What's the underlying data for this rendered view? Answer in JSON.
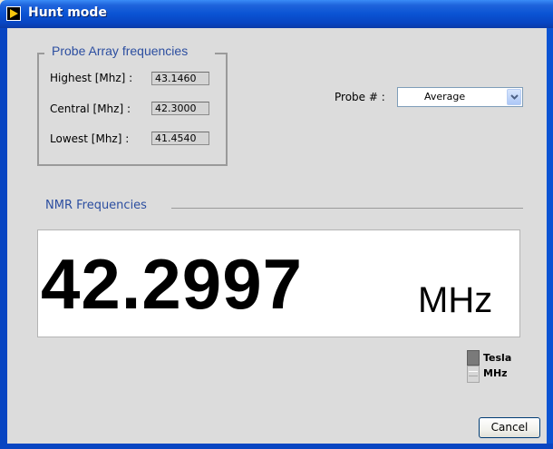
{
  "window": {
    "title": "Hunt mode",
    "colors": {
      "titlebar": "#0a53d3",
      "client": "#dcdcdc",
      "legend_text": "#2c4ea0"
    }
  },
  "probe_array": {
    "legend": "Probe Array frequencies",
    "rows": [
      {
        "label": "Highest [Mhz] :",
        "value": "43.1460"
      },
      {
        "label": "Central [Mhz] :",
        "value": "42.3000"
      },
      {
        "label": "Lowest [Mhz] :",
        "value": "41.4540"
      }
    ]
  },
  "probe": {
    "label": "Probe # :",
    "selected": "Average"
  },
  "nmr": {
    "label": "NMR Frequencies",
    "value": "42.2997",
    "unit": "MHz"
  },
  "unit_toggle": {
    "options": [
      "Tesla",
      "MHz"
    ]
  },
  "buttons": {
    "cancel": "Cancel"
  }
}
